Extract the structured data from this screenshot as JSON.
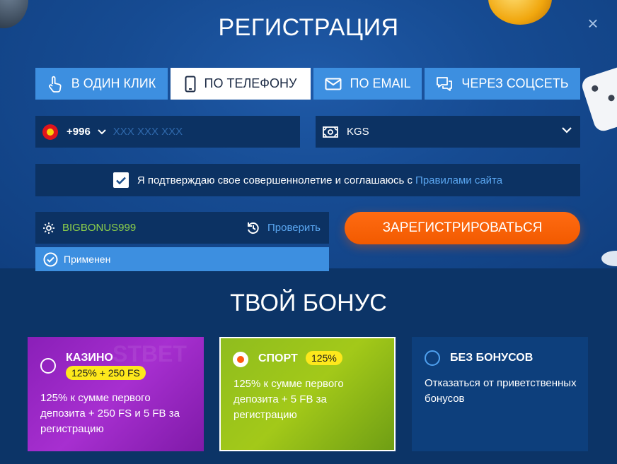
{
  "title": "РЕГИСТРАЦИЯ",
  "close_label": "×",
  "tabs": [
    {
      "label": "В ОДИН КЛИК",
      "icon": "hand-pointer-icon",
      "active": false
    },
    {
      "label": "ПО ТЕЛЕФОНУ",
      "icon": "phone-icon",
      "active": true
    },
    {
      "label": "ПО EMAIL",
      "icon": "envelope-icon",
      "active": false
    },
    {
      "label": "ЧЕРЕЗ СОЦСЕТЬ",
      "icon": "chat-icon",
      "active": false
    }
  ],
  "phone": {
    "country_code": "+996",
    "placeholder": "XXX XXX XXX",
    "flag_icon": "kyrgyzstan-flag-icon"
  },
  "currency": {
    "value": "KGS",
    "icon": "banknote-icon"
  },
  "agreement": {
    "text": "Я подтверждаю свое совершеннолетие и соглашаюсь с",
    "link": "Правилами сайта",
    "checked": true
  },
  "promo": {
    "value": "BIGBONUS999",
    "check_label": "Проверить",
    "applied_label": "Применен"
  },
  "register_label": "ЗАРЕГИСТРИРОВАТЬСЯ",
  "bonus_title": "ТВОЙ БОНУС",
  "bonuses": [
    {
      "name": "КАЗИНО",
      "badge": "125% + 250 FS",
      "desc": "125% к сумме первого депозита + 250 FS и 5 FB за регистрацию",
      "selected": false
    },
    {
      "name": "СПОРТ",
      "badge": "125%",
      "desc": "125% к сумме первого депозита + 5 FB за регистрацию",
      "selected": true
    },
    {
      "name": "БЕЗ БОНУСОВ",
      "badge": "",
      "desc": "Отказаться от приветственных бонусов",
      "selected": false
    }
  ],
  "colors": {
    "accent": "#3d8fe0",
    "cta": "#f25a00",
    "promo_text": "#8ed14a",
    "badge": "#fde81c"
  }
}
